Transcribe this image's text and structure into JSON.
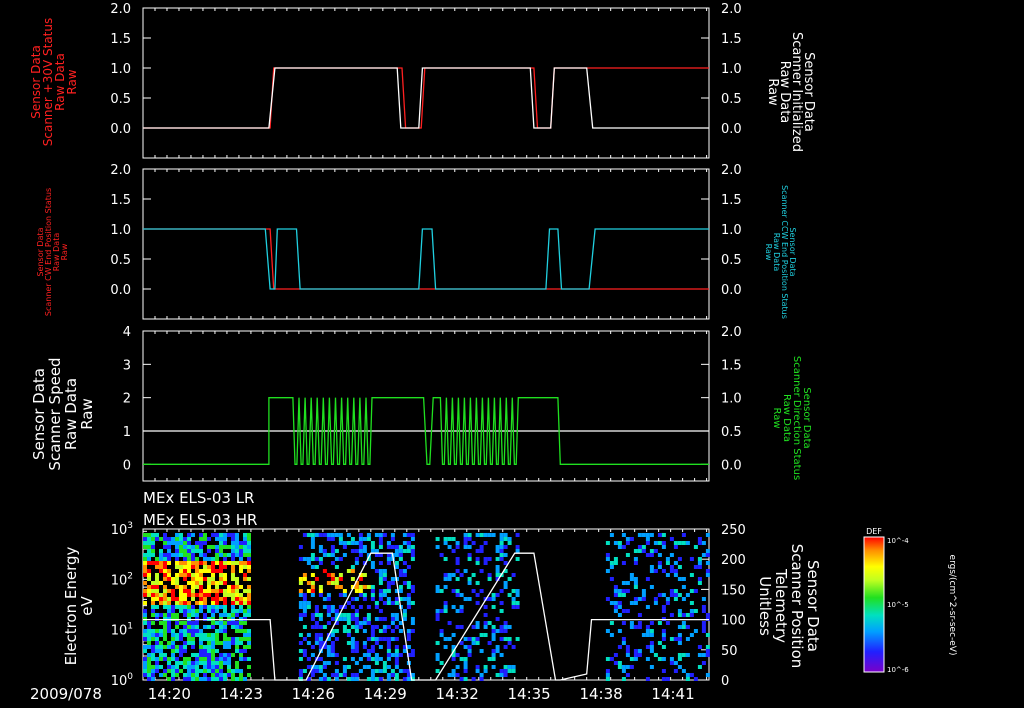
{
  "time_axis": {
    "date_label": "2009/078",
    "ticks": [
      "14:20",
      "14:23",
      "14:26",
      "14:29",
      "14:32",
      "14:35",
      "14:38",
      "14:41"
    ]
  },
  "panel1": {
    "left_label": [
      "Sensor Data",
      "Scanner +30V Status",
      "Raw Data",
      "Raw"
    ],
    "right_label": [
      "Sensor Data",
      "Scanner Initialized",
      "Raw Data",
      "Raw"
    ],
    "left_color": "#ff2020",
    "right_color": "#ffffff"
  },
  "panel2": {
    "left_label": [
      "Sensor Data",
      "Scanner CW End Position Status",
      "Raw Data",
      "Raw"
    ],
    "right_label": [
      "Sensor Data",
      "Scanner CCW End Position Status",
      "Raw Data",
      "Raw"
    ],
    "left_color": "#ff2020",
    "right_color": "#20d0e0"
  },
  "panel3": {
    "left_label": [
      "Sensor Data",
      "Scanner Speed",
      "Raw Data",
      "Raw"
    ],
    "right_label": [
      "Sensor Data",
      "Scanner Direction Status",
      "Raw Data",
      "Raw"
    ],
    "left_color": "#ffffff",
    "right_color": "#20e020"
  },
  "panel4": {
    "titles": [
      "MEx ELS-03 LR",
      "MEx ELS-03 HR"
    ],
    "left_label": [
      "Electron Energy",
      "eV"
    ],
    "right_label": [
      "Sensor Data",
      "Scanner Position",
      "Telemetry",
      "Unitless"
    ],
    "colorbar_title": "DEF",
    "colorbar_unit": "ergs/(cm^2-sr-sec-eV)",
    "colorbar_ticks": [
      "10^-4",
      "10^-5",
      "10^-6"
    ]
  },
  "chart_data": [
    {
      "type": "line",
      "panel": "Scanner +30V / Scanner Initialized",
      "xlim": [
        "14:18.9",
        "14:42.6"
      ],
      "left_ylim": [
        -0.5,
        2.0
      ],
      "left_yticks": [
        0.0,
        0.5,
        1.0,
        1.5,
        2.0
      ],
      "right_ylim": [
        -0.5,
        2.0
      ],
      "right_yticks": [
        0.0,
        0.5,
        1.0,
        1.5,
        2.0
      ],
      "series": [
        {
          "name": "Scanner +30V Status",
          "color": "#ff2020",
          "axis": "left",
          "x": [
            0,
            5.3,
            5.45,
            10.8,
            10.95,
            11.6,
            11.75,
            16.3,
            16.45,
            17.0,
            17.15,
            23.6
          ],
          "y": [
            0,
            0,
            1,
            1,
            0,
            0,
            1,
            1,
            0,
            0,
            1,
            1
          ]
        },
        {
          "name": "Scanner Initialized",
          "color": "#ffffff",
          "axis": "right",
          "x": [
            0,
            5.25,
            5.5,
            10.6,
            10.75,
            11.5,
            11.65,
            16.15,
            16.3,
            17.0,
            17.15,
            18.5,
            18.75,
            23.6
          ],
          "y": [
            0,
            0,
            1,
            1,
            0,
            0,
            1,
            1,
            0,
            0,
            1,
            1,
            0,
            0
          ]
        }
      ]
    },
    {
      "type": "line",
      "panel": "Scanner CW / CCW End Position Status",
      "xlim": [
        "14:18.9",
        "14:42.6"
      ],
      "left_ylim": [
        -0.5,
        2.0
      ],
      "left_yticks": [
        0.0,
        0.5,
        1.0,
        1.5,
        2.0
      ],
      "right_ylim": [
        -0.5,
        2.0
      ],
      "right_yticks": [
        0.0,
        0.5,
        1.0,
        1.5,
        2.0
      ],
      "series": [
        {
          "name": "Scanner CW End Position Status",
          "color": "#ff2020",
          "axis": "left",
          "x": [
            0,
            5.3,
            5.45,
            6.2,
            6.3,
            23.6
          ],
          "y": [
            1,
            1,
            0,
            0,
            0,
            0
          ]
        },
        {
          "name": "Scanner CCW End Position Status",
          "color": "#20d0e0",
          "axis": "right",
          "x": [
            0,
            5.1,
            5.3,
            5.5,
            5.6,
            6.4,
            6.55,
            11.5,
            11.65,
            12.05,
            12.2,
            16.8,
            16.95,
            17.3,
            17.45,
            18.6,
            18.85,
            23.6
          ],
          "y": [
            1,
            1,
            0,
            0,
            1,
            1,
            0,
            0,
            1,
            1,
            0,
            0,
            1,
            1,
            0,
            0,
            1,
            1
          ]
        }
      ]
    },
    {
      "type": "line",
      "panel": "Scanner Speed / Scanner Direction Status",
      "xlim": [
        "14:18.9",
        "14:42.6"
      ],
      "left_ylim": [
        -0.5,
        4.0
      ],
      "left_yticks": [
        0,
        1,
        2,
        3,
        4
      ],
      "right_ylim": [
        -0.25,
        2.0
      ],
      "right_yticks": [
        0.0,
        0.5,
        1.0,
        1.5,
        2.0
      ],
      "series": [
        {
          "name": "Scanner Speed",
          "color": "#ffffff",
          "axis": "left",
          "x": [
            0,
            23.6
          ],
          "y": [
            1,
            1
          ]
        },
        {
          "name": "Scanner Direction Status",
          "color": "#20e020",
          "axis": "right",
          "pattern": "square_waves",
          "segments": [
            {
              "x0": 0,
              "x1": 5.25,
              "y": 0
            },
            {
              "x0": 5.25,
              "x1": 6.25,
              "y": 1
            },
            {
              "osc_start": 6.25,
              "osc_end": 9.55,
              "count": 13
            },
            {
              "x0": 9.6,
              "x1": 11.7,
              "y": 1
            },
            {
              "osc_start": 11.7,
              "osc_end": 12.1,
              "count": 1
            },
            {
              "osc_start": 12.4,
              "osc_end": 15.65,
              "count": 13
            },
            {
              "x0": 15.65,
              "x1": 17.3,
              "y": 1
            },
            {
              "x0": 17.4,
              "x1": 23.6,
              "y": 0
            }
          ]
        }
      ]
    },
    {
      "type": "heatmap",
      "panel": "Electron Energy spectrogram + Scanner Position",
      "xlim": [
        "14:18.9",
        "14:42.6"
      ],
      "left_yscale": "log",
      "left_ylim": [
        1,
        1000
      ],
      "left_yticks": [
        "10^0",
        "10^1",
        "10^2",
        "10^3"
      ],
      "right_ylim": [
        0,
        250
      ],
      "right_yticks": [
        0,
        50,
        100,
        150,
        200,
        250
      ],
      "data_intervals": [
        [
          0,
          4.5
        ],
        [
          6.5,
          11.3
        ],
        [
          12.2,
          15.6
        ],
        [
          19.3,
          23.6
        ]
      ],
      "colorscale": [
        "#7a00c8",
        "#2020ff",
        "#00a0ff",
        "#00e0c0",
        "#20e020",
        "#c0ff20",
        "#ffff00",
        "#ff9000",
        "#ff0000"
      ],
      "series": [
        {
          "name": "Scanner Position",
          "color": "#ffffff",
          "axis": "right",
          "x": [
            0,
            5.3,
            5.5,
            6.8,
            9.5,
            10.4,
            11.2,
            11.3,
            12.2,
            15.5,
            16.3,
            17.2,
            17.4,
            18.5,
            18.7,
            23.6
          ],
          "y": [
            100,
            100,
            0,
            0,
            210,
            210,
            0,
            0,
            0,
            210,
            210,
            0,
            0,
            10,
            100,
            100
          ]
        }
      ]
    }
  ]
}
